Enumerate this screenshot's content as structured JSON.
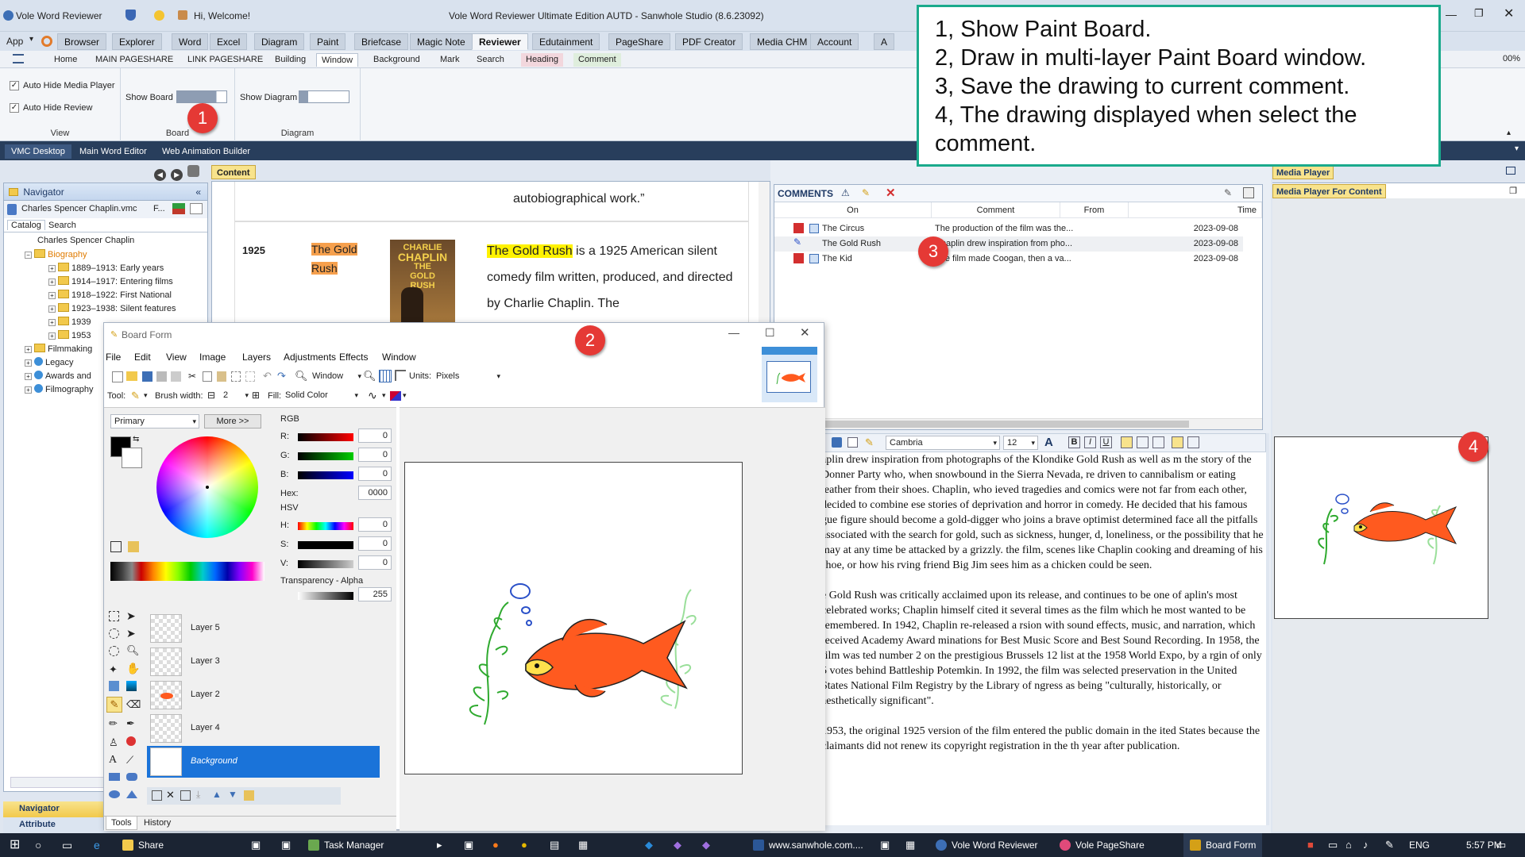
{
  "titlebar": {
    "app_name": "Vole Word Reviewer",
    "welcome": "Hi, Welcome!",
    "window_title": "Vole Word Reviewer Ultimate Edition AUTD - Sanwhole Studio (8.6.23092)"
  },
  "ribbon": {
    "app_menu": "App",
    "tabs": [
      "Browser",
      "Explorer",
      "Word",
      "Excel",
      "Diagram",
      "Paint",
      "Briefcase",
      "Magic Note",
      "Reviewer",
      "Edutainment",
      "PageShare",
      "PDF Creator",
      "Media CHM",
      "Account",
      "A"
    ],
    "active_tab": "Reviewer",
    "subtabs": [
      "Home",
      "MAIN PAGESHARE",
      "LINK PAGESHARE",
      "Building",
      "Window",
      "Background",
      "Mark",
      "Search",
      "Heading",
      "Comment"
    ],
    "zoom": "00%",
    "view_group": {
      "label": "View",
      "auto_hide_media": "Auto Hide Media Player",
      "auto_hide_review": "Auto Hide Review"
    },
    "board_group": {
      "label": "Board",
      "show_board": "Show Board"
    },
    "diagram_group": {
      "label": "Diagram",
      "show_diagram": "Show Diagram"
    }
  },
  "docbar": {
    "tabs": [
      "VMC Desktop",
      "Main Word Editor",
      "Web Animation Builder"
    ]
  },
  "navigator": {
    "title": "Navigator",
    "file": "Charles Spencer Chaplin.vmc",
    "file_suffix": "F...",
    "tabs": [
      "Catalog",
      "Search"
    ],
    "tree": [
      {
        "label": "Charles Spencer Chaplin",
        "level": 0,
        "folder": false
      },
      {
        "label": "Biography",
        "level": 0,
        "folder": true,
        "highlight": true
      },
      {
        "label": "1889–1913: Early years",
        "level": 2,
        "folder": true
      },
      {
        "label": "1914–1917: Entering films",
        "level": 2,
        "folder": true
      },
      {
        "label": "1918–1922: First National",
        "level": 2,
        "folder": true
      },
      {
        "label": "1923–1938: Silent features",
        "level": 2,
        "folder": true
      },
      {
        "label": "1939",
        "level": 2,
        "folder": true
      },
      {
        "label": "1953",
        "level": 2,
        "folder": true
      },
      {
        "label": "Filmmaking",
        "level": 0,
        "folder": true
      },
      {
        "label": "Legacy",
        "level": 0,
        "folder": false
      },
      {
        "label": "Awards and",
        "level": 0,
        "folder": false
      },
      {
        "label": "Filmography",
        "level": 0,
        "folder": false
      }
    ],
    "bottom_tabs": [
      "Navigator",
      "Attribute"
    ]
  },
  "content": {
    "tab": "Content",
    "prev_text": "autobiographical work.”",
    "year": "1925",
    "title_cell": "The Gold Rush",
    "poster_text": [
      "CHARLIE",
      "CHAPLIN",
      "THE",
      "GOLD",
      "RUSH"
    ],
    "body_highlight": "The Gold Rush",
    "body_rest": " is a 1925 American silent comedy film written, produced, and directed by Charlie Chaplin. The"
  },
  "comments": {
    "title": "COMMENTS",
    "columns": [
      "On",
      "Comment",
      "From",
      "Time"
    ],
    "rows": [
      {
        "on": "The Circus",
        "comment": "The production of the film was the...",
        "from": "",
        "time": "2023-09-08"
      },
      {
        "on": "The Gold Rush",
        "comment": "Chaplin drew inspiration from pho...",
        "from": "",
        "time": "2023-09-08"
      },
      {
        "on": "The Kid",
        "comment": "The film made Coogan, then a va...",
        "from": "",
        "time": "2023-09-08"
      }
    ]
  },
  "editor": {
    "font": "Cambria",
    "size": "12",
    "paragraphs": [
      "aplin drew inspiration from photographs of the Klondike Gold Rush as well as m the story of the Donner Party who, when snowbound in the Sierra Nevada, re driven to cannibalism or eating leather from their shoes. Chaplin, who ieved tragedies and comics were not far from each other, decided to combine ese stories of deprivation and horror in comedy. He decided that his famous gue figure should become a gold-digger who joins a brave optimist determined face all the pitfalls associated with the search for gold, such as sickness, hunger, d, loneliness, or the possibility that he may at any time be attacked by a grizzly. the film, scenes like Chaplin cooking and dreaming of his shoe, or how his rving friend Big Jim sees him as a chicken could be seen.",
      "e Gold Rush was critically acclaimed upon its release, and continues to be one of aplin's most celebrated works; Chaplin himself cited it several times as the film which he most wanted to be remembered. In 1942, Chaplin re-released a rsion with sound effects, music, and narration, which received Academy Award minations for Best Music Score and Best Sound Recording. In 1958, the film was ted number 2 on the prestigious Brussels 12 list at the 1958 World Expo, by a rgin of only 5 votes behind Battleship Potemkin. In 1992, the film was selected preservation in the United States National Film Registry by the Library of ngress as being \"culturally, historically, or aesthetically significant\".",
      "1953, the original 1925 version of the film entered the public domain in the ited States because the claimants did not renew its copyright registration in the th year after publication."
    ]
  },
  "media": {
    "title": "Media Player",
    "subtitle": "Media Player For Content"
  },
  "board": {
    "title": "Board Form",
    "menus": [
      "File",
      "Edit",
      "View",
      "Image",
      "Layers",
      "Adjustments",
      "Effects",
      "Window"
    ],
    "window_select": "Window",
    "units_label": "Units:",
    "units": "Pixels",
    "tool_label": "Tool:",
    "brush_label": "Brush width:",
    "brush_width": "2",
    "fill_label": "Fill:",
    "fill": "Solid Color",
    "palette_mode": "Primary",
    "more": "More >>",
    "rgb_label": "RGB",
    "r_label": "R:",
    "r": "0",
    "g_label": "G:",
    "g": "0",
    "b_label": "B:",
    "b": "0",
    "hex_label": "Hex:",
    "hex": "0000",
    "hsv_label": "HSV",
    "h_label": "H:",
    "h": "0",
    "s_label": "S:",
    "s": "0",
    "v_label": "V:",
    "v": "0",
    "alpha_label": "Transparency - Alpha",
    "alpha": "255",
    "layers": [
      "Layer 5",
      "Layer 3",
      "Layer 2",
      "Layer 4",
      "Background"
    ],
    "bottom_tabs": [
      "Tools",
      "History"
    ]
  },
  "instructions": {
    "lines": [
      "1, Show Paint Board.",
      "2, Draw in multi-layer Paint Board window.",
      "3, Save the drawing to current comment.",
      "4, The drawing displayed when select the comment."
    ]
  },
  "badges": [
    "1",
    "2",
    "3",
    "4"
  ],
  "taskbar": {
    "items": [
      "Share",
      "Task Manager",
      "www.sanwhole.com....",
      "Vole Word Reviewer",
      "Vole PageShare",
      "Board Form"
    ],
    "lang": "ENG",
    "time": "5:57 PM"
  },
  "colors": {
    "fish": "#ff5a1f",
    "accent": "#1aaa8c",
    "badge": "#e53935",
    "highlight": "#fff200",
    "title_cell": "#f6a04d"
  }
}
